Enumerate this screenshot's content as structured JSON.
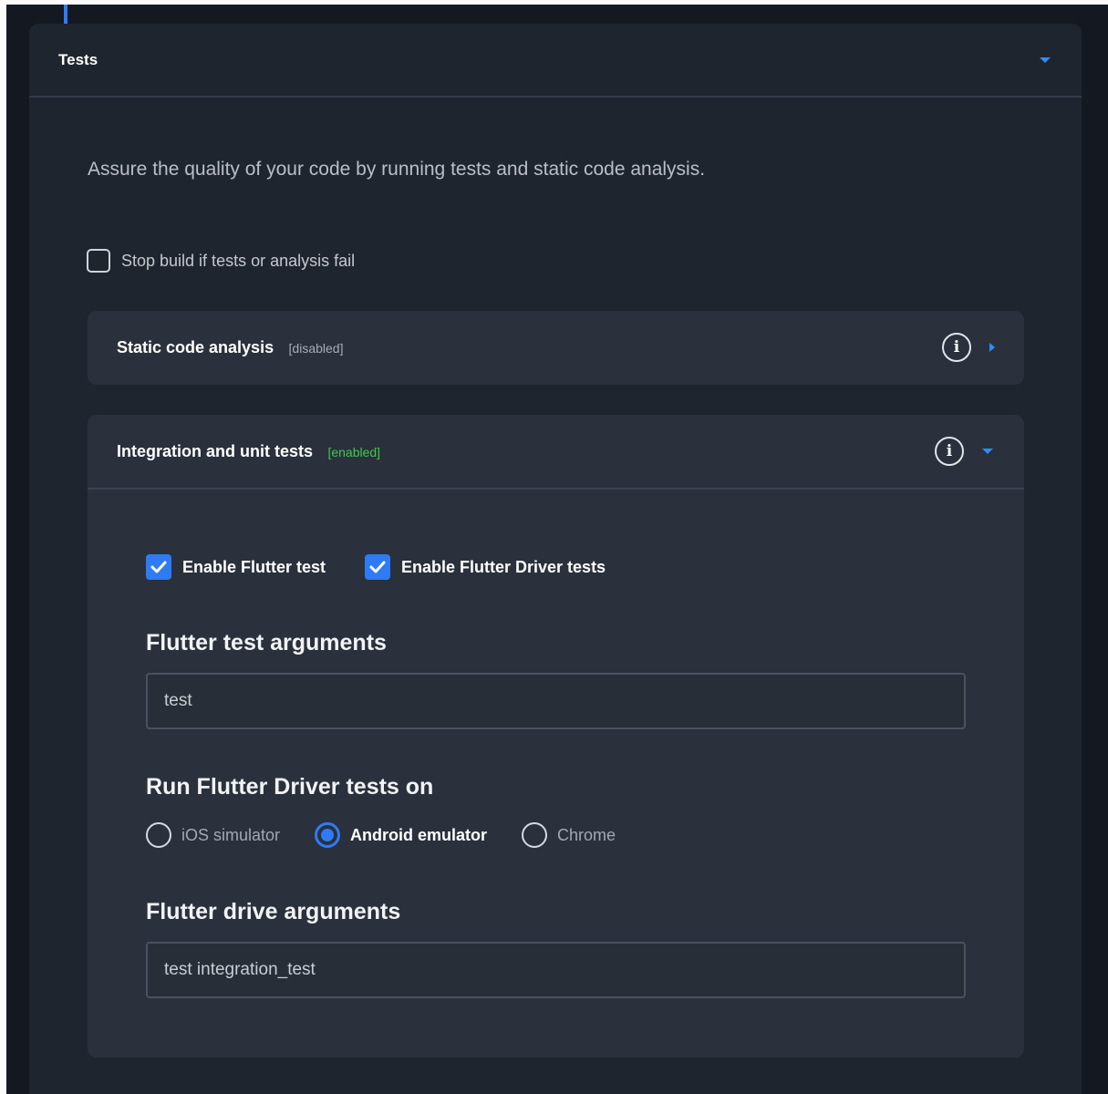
{
  "panel": {
    "title": "Tests",
    "description": "Assure the quality of your code by running tests and static code analysis.",
    "stop_build_label": "Stop build if tests or analysis fail"
  },
  "static_analysis": {
    "title": "Static code analysis",
    "status": "[disabled]"
  },
  "integration_tests": {
    "title": "Integration and unit tests",
    "status": "[enabled]",
    "enable_flutter_test_label": "Enable Flutter test",
    "enable_flutter_driver_label": "Enable Flutter Driver tests",
    "flutter_test_args_label": "Flutter test arguments",
    "flutter_test_args_value": "test",
    "run_driver_on_label": "Run Flutter Driver tests on",
    "run_targets": [
      {
        "label": "iOS simulator",
        "selected": false
      },
      {
        "label": "Android emulator",
        "selected": true
      },
      {
        "label": "Chrome",
        "selected": false
      }
    ],
    "flutter_drive_args_label": "Flutter drive arguments",
    "flutter_drive_args_value": "test integration_test"
  },
  "icons": {
    "info": "i"
  },
  "colors": {
    "accent": "#2f7bf6",
    "enabled": "#3ec94a",
    "background": "#131821",
    "panel": "#1f252f",
    "card": "#2a313c"
  }
}
